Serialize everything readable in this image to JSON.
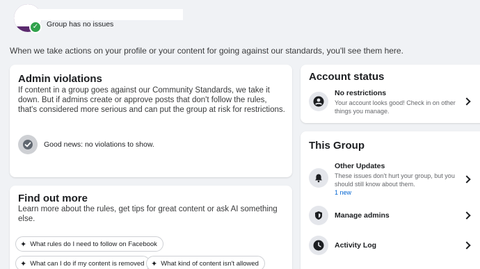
{
  "header": {
    "status_text": "Group has no issues"
  },
  "intro_text": "When we take actions on your profile or your content for going against our standards, you'll see them here.",
  "admin_violations": {
    "title": "Admin violations",
    "description": "If content in a group goes against our Community Standards, we take it down. But if admins create or approve posts that don't follow the rules, that's considered more serious and can put the group at risk for restrictions.",
    "good_news": "Good news: no violations to show."
  },
  "find_out_more": {
    "title": "Find out more",
    "description": "Learn more about the rules, get tips for great content or ask AI something else.",
    "suggestions": [
      "What rules do I need to follow on Facebook",
      "What can I do if my content is removed",
      "What kind of content isn't allowed"
    ]
  },
  "account_status": {
    "title": "Account status",
    "item_title": "No restrictions",
    "item_desc": "Your account looks good! Check in on other things you manage."
  },
  "this_group": {
    "title": "This Group",
    "other_updates_title": "Other Updates",
    "other_updates_desc": "These issues don't hurt your group, but you should still know about them.",
    "other_updates_link": "1 new",
    "manage_admins": "Manage admins",
    "activity_log": "Activity Log"
  },
  "colors": {
    "page_bg": "#f0f2f5",
    "card_bg": "#ffffff",
    "success_green": "#31a24c",
    "link_blue": "#0064d1",
    "icon_bg": "#e4e6eb"
  }
}
